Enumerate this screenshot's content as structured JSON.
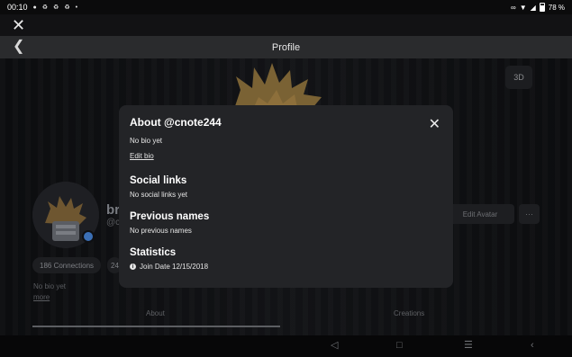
{
  "status_bar": {
    "time": "00:10",
    "battery_percent": "78 %"
  },
  "header": {
    "title": "Profile"
  },
  "background": {
    "view_3d_label": "3D",
    "username_fragment": "br",
    "handle_fragment": "@c",
    "connections_label": "186 Connections",
    "second_pill_fragment": "24",
    "bio_text": "No bio yet",
    "more_link": "more",
    "edit_avatar_label": "Edit Avatar",
    "more_options_label": "···",
    "tabs": [
      {
        "label": "About"
      },
      {
        "label": "Creations"
      }
    ]
  },
  "modal": {
    "title": "About @cnote244",
    "bio": "No bio yet",
    "edit_bio_link": "Edit bio",
    "social": {
      "heading": "Social links",
      "text": "No social links yet"
    },
    "previous_names": {
      "heading": "Previous names",
      "text": "No previous names"
    },
    "statistics": {
      "heading": "Statistics",
      "join_date": "Join Date 12/15/2018"
    }
  },
  "colors": {
    "modal_bg": "#232427",
    "header_bg": "#2a2b2d",
    "presence_blue": "#3b6fb5"
  }
}
